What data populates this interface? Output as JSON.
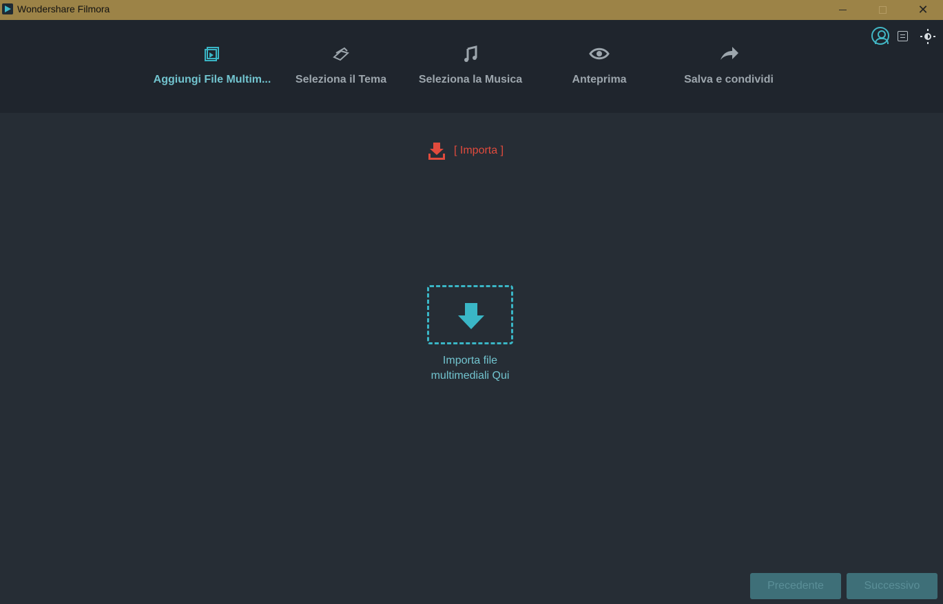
{
  "window": {
    "title": "Wondershare Filmora",
    "controls": [
      "minimize",
      "maximize",
      "close"
    ]
  },
  "toolbar": {
    "icons": [
      "user-icon",
      "menu-icon",
      "theme-toggle-icon"
    ]
  },
  "steps": [
    {
      "label": "Aggiungi File Multim...",
      "icon": "media-add-icon",
      "active": true
    },
    {
      "label": "Seleziona il Tema",
      "icon": "theme-icon",
      "active": false
    },
    {
      "label": "Seleziona la Musica",
      "icon": "music-icon",
      "active": false
    },
    {
      "label": "Anteprima",
      "icon": "eye-icon",
      "active": false
    },
    {
      "label": "Salva e condividi",
      "icon": "share-icon",
      "active": false
    }
  ],
  "main": {
    "import_link": "[ Importa ]",
    "dropzone_text": "Importa file\nmultimediali Qui"
  },
  "footer": {
    "previous": "Precedente",
    "next": "Successivo"
  },
  "colors": {
    "titlebar": "#9c8347",
    "background": "#262d35",
    "header": "#1f252d",
    "accent": "#3ab6c6",
    "import": "#e14b3d",
    "disabled_button": "#3e6f78"
  }
}
